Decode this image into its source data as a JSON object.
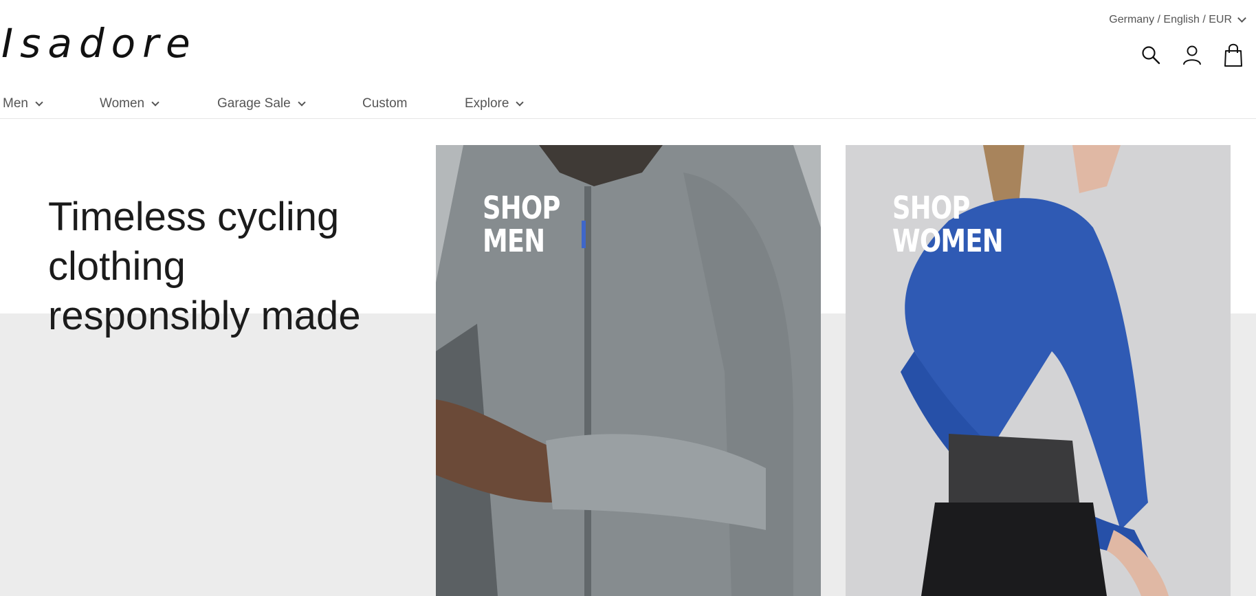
{
  "brand": {
    "logo_text": "Isadore"
  },
  "locale": {
    "label": "Germany / English / EUR"
  },
  "icons": {
    "search": "search-icon",
    "account": "user-icon",
    "cart": "bag-icon"
  },
  "nav": {
    "items": [
      {
        "label": "Men",
        "has_dropdown": true
      },
      {
        "label": "Women",
        "has_dropdown": true
      },
      {
        "label": "Garage Sale",
        "has_dropdown": true
      },
      {
        "label": "Custom",
        "has_dropdown": false
      },
      {
        "label": "Explore",
        "has_dropdown": true
      }
    ]
  },
  "hero": {
    "headline": "Timeless cycling clothing responsibly made",
    "cards": [
      {
        "line1": "SHOP",
        "line2": "MEN"
      },
      {
        "line1": "SHOP",
        "line2": "WOMEN"
      }
    ]
  },
  "colors": {
    "hero_band": "#ececec",
    "nav_text": "#555555",
    "men_jersey": "#8f9598",
    "women_jersey": "#2b5bb4"
  }
}
